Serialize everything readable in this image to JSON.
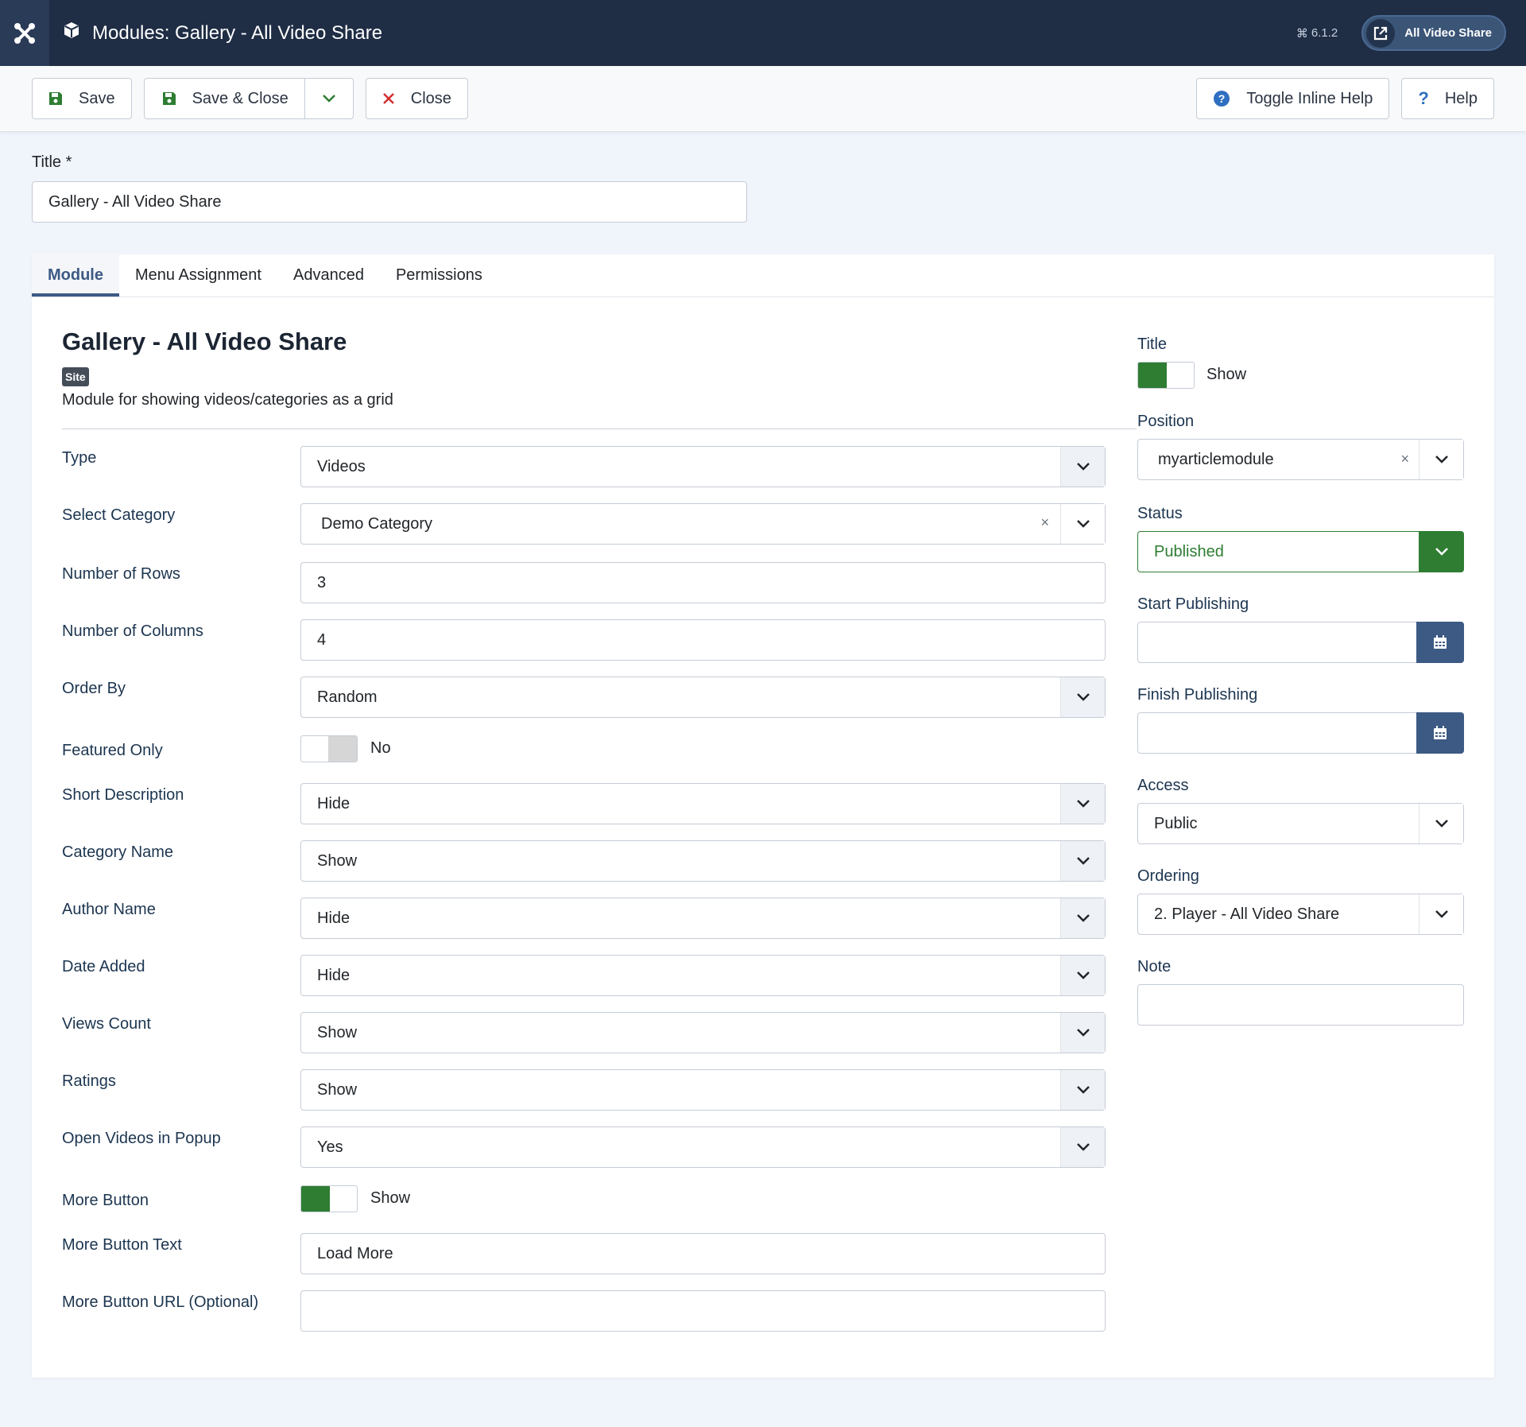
{
  "header": {
    "title": "Modules: Gallery - All Video Share",
    "version": "6.1.2",
    "site_button": "All Video Share"
  },
  "toolbar": {
    "save": "Save",
    "save_close": "Save & Close",
    "close": "Close",
    "toggle_help": "Toggle Inline Help",
    "help": "Help"
  },
  "title_field": {
    "label": "Title *",
    "value": "Gallery - All Video Share"
  },
  "tabs": [
    "Module",
    "Menu Assignment",
    "Advanced",
    "Permissions"
  ],
  "module": {
    "title": "Gallery - All Video Share",
    "badge": "Site",
    "description": "Module for showing videos/categories as a grid"
  },
  "fields": {
    "type": {
      "label": "Type",
      "value": "Videos"
    },
    "category": {
      "label": "Select Category",
      "value": "Demo Category"
    },
    "rows": {
      "label": "Number of Rows",
      "value": "3"
    },
    "columns": {
      "label": "Number of Columns",
      "value": "4"
    },
    "order_by": {
      "label": "Order By",
      "value": "Random"
    },
    "featured": {
      "label": "Featured Only",
      "value": "No"
    },
    "short_desc": {
      "label": "Short Description",
      "value": "Hide"
    },
    "category_name": {
      "label": "Category Name",
      "value": "Show"
    },
    "author_name": {
      "label": "Author Name",
      "value": "Hide"
    },
    "date_added": {
      "label": "Date Added",
      "value": "Hide"
    },
    "views_count": {
      "label": "Views Count",
      "value": "Show"
    },
    "ratings": {
      "label": "Ratings",
      "value": "Show"
    },
    "popup": {
      "label": "Open Videos in Popup",
      "value": "Yes"
    },
    "more_button": {
      "label": "More Button",
      "value": "Show"
    },
    "more_text": {
      "label": "More Button Text",
      "value": "Load More"
    },
    "more_url": {
      "label": "More Button URL (Optional)",
      "value": ""
    }
  },
  "side": {
    "title": {
      "label": "Title",
      "value": "Show"
    },
    "position": {
      "label": "Position",
      "value": "myarticlemodule"
    },
    "status": {
      "label": "Status",
      "value": "Published"
    },
    "start": {
      "label": "Start Publishing",
      "value": ""
    },
    "finish": {
      "label": "Finish Publishing",
      "value": ""
    },
    "access": {
      "label": "Access",
      "value": "Public"
    },
    "ordering": {
      "label": "Ordering",
      "value": "2. Player - All Video Share"
    },
    "note": {
      "label": "Note",
      "value": ""
    }
  },
  "colors": {
    "header_bg": "#1f2d45",
    "accent": "#3c5a84",
    "success": "#2e7d32",
    "danger": "#d32f2f"
  },
  "icons": [
    "joomla-logo-icon",
    "cube-icon",
    "external-link-icon",
    "save-icon",
    "close-x-icon",
    "chevron-down-icon",
    "question-circle-icon",
    "question-icon",
    "calendar-icon"
  ]
}
